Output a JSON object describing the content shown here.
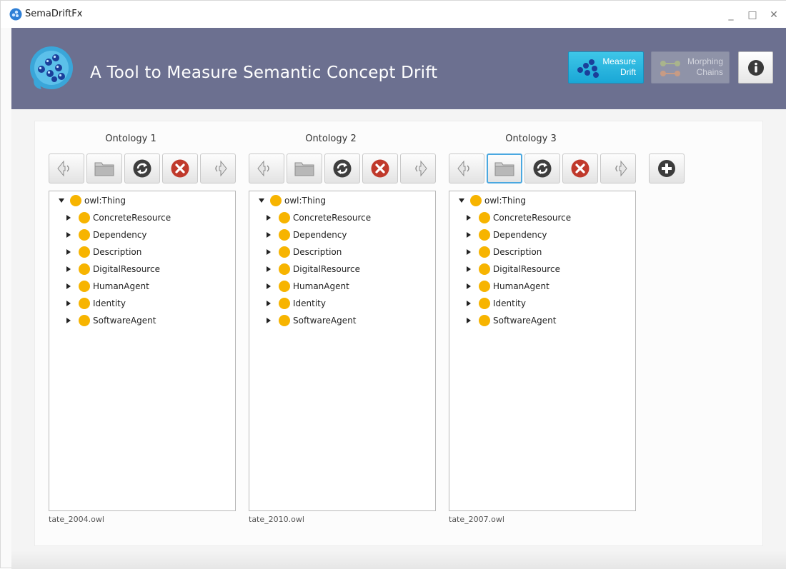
{
  "window": {
    "title": "SemaDriftFx",
    "minimize": "_",
    "maximize": "□",
    "close": "✕"
  },
  "header": {
    "title": "A Tool to Measure Semantic Concept Drift",
    "measure_btn": {
      "line1": "Measure",
      "line2": "Drift"
    },
    "morph_btn": {
      "line1": "Morphing",
      "line2": "Chains"
    }
  },
  "colors": {
    "header_bg": "#6c7090",
    "accent": "#1aa7d6",
    "class_dot": "#f7b400"
  },
  "ontologies": [
    {
      "title": "Ontology 1",
      "root": "owl:Thing",
      "classes": [
        "ConcreteResource",
        "Dependency",
        "Description",
        "DigitalResource",
        "HumanAgent",
        "Identity",
        "SoftwareAgent"
      ],
      "file": "tate_2004.owl"
    },
    {
      "title": "Ontology 2",
      "root": "owl:Thing",
      "classes": [
        "ConcreteResource",
        "Dependency",
        "Description",
        "DigitalResource",
        "HumanAgent",
        "Identity",
        "SoftwareAgent"
      ],
      "file": "tate_2010.owl"
    },
    {
      "title": "Ontology 3",
      "root": "owl:Thing",
      "classes": [
        "ConcreteResource",
        "Dependency",
        "Description",
        "DigitalResource",
        "HumanAgent",
        "Identity",
        "SoftwareAgent"
      ],
      "file": "tate_2007.owl"
    }
  ]
}
